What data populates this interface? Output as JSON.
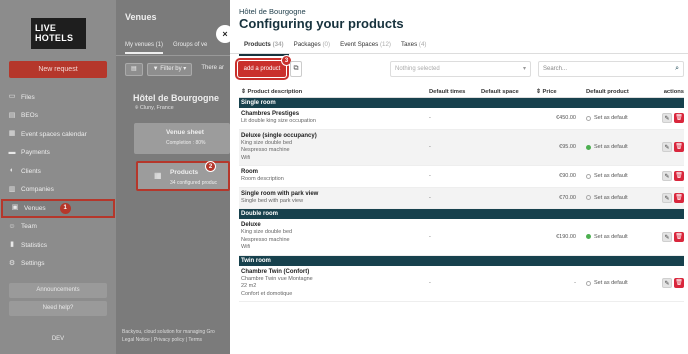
{
  "sidebar": {
    "logo": [
      "LIVE",
      "HOTELS"
    ],
    "new_request": "New request",
    "items": [
      {
        "label": "Files",
        "icon": "files-icon",
        "glyph": "▭"
      },
      {
        "label": "BEOs",
        "icon": "beo-icon",
        "glyph": "▤"
      },
      {
        "label": "Event spaces calendar",
        "icon": "calendar-icon",
        "glyph": "▦"
      },
      {
        "label": "Payments",
        "icon": "payment-icon",
        "glyph": "▬"
      },
      {
        "label": "Clients",
        "icon": "clients-icon",
        "glyph": "◐"
      },
      {
        "label": "Companies",
        "icon": "companies-icon",
        "glyph": "▥"
      },
      {
        "label": "Venues",
        "icon": "venues-icon",
        "glyph": "▣",
        "active": true,
        "badge": "1"
      },
      {
        "label": "Team",
        "icon": "team-icon",
        "glyph": "☺"
      },
      {
        "label": "Statistics",
        "icon": "statistics-icon",
        "glyph": "▮"
      },
      {
        "label": "Settings",
        "icon": "settings-icon",
        "glyph": "⚙"
      }
    ],
    "announcements": "Announcements",
    "help": "Need help?",
    "dev": "DEV"
  },
  "middle": {
    "title": "Venues",
    "tabs": [
      "My venues (1)",
      "Groups of ve"
    ],
    "filter_label": "Filter by",
    "there_are": "There ar",
    "hotel": "Hôtel de Bourgogne",
    "city": "Cluny, France",
    "venue_sheet": "Venue sheet",
    "venue_sheet_sub": "Completion : 80%",
    "products": "Products",
    "products_sub": "34 configured produc",
    "products_badge": "2",
    "footer": [
      "Backyou, cloud solution for managing Gro",
      "Legal Notice  |  Privacy policy  |  Terms"
    ]
  },
  "modal": {
    "subtitle": "Hôtel de Bourgogne",
    "title": "Configuring your products",
    "tabs": [
      {
        "label": "Products",
        "count": "(34)",
        "selected": true
      },
      {
        "label": "Packages",
        "count": "(0)"
      },
      {
        "label": "Event Spaces",
        "count": "(12)"
      },
      {
        "label": "Taxes",
        "count": "(4)"
      }
    ],
    "add_product": "add a product",
    "add_badge": "3",
    "selector_placeholder": "Nothing selected",
    "search_placeholder": "Search...",
    "columns": [
      "Product description",
      "Default times",
      "Default space",
      "Price",
      "Default product",
      "actions"
    ],
    "groups": [
      {
        "label": "Single room",
        "rows": [
          {
            "name": "Chambres Prestiges",
            "desc": [
              "Lit double king size occupation"
            ],
            "times": "-",
            "space": "",
            "price": "€450.00",
            "default_label": "Set as default",
            "is_default": false
          },
          {
            "name": "Deluxe (single occupancy)",
            "desc": [
              "King size double bed",
              "Nespresso machine",
              "Wifi"
            ],
            "times": "-",
            "space": "",
            "price": "€95.00",
            "default_label": "Set as default",
            "is_default": true
          },
          {
            "name": "Room",
            "desc": [
              "Room description"
            ],
            "times": "-",
            "space": "",
            "price": "€90.00",
            "default_label": "Set as default",
            "is_default": false
          },
          {
            "name": "Single room with park view",
            "desc": [
              "Single bed with park view"
            ],
            "times": "-",
            "space": "",
            "price": "€70.00",
            "default_label": "Set as default",
            "is_default": false
          }
        ]
      },
      {
        "label": "Double room",
        "rows": [
          {
            "name": "Deluxe",
            "desc": [
              "King size double bed",
              "Nespresso machine",
              "Wifi"
            ],
            "times": "-",
            "space": "",
            "price": "€190.00",
            "default_label": "Set as default",
            "is_default": true
          }
        ]
      },
      {
        "label": "Twin room",
        "rows": [
          {
            "name": "Chambre Twin (Confort)",
            "desc": [
              "Chambre Twin vue Montagne",
              "22 m2",
              "Confort et domotique"
            ],
            "times": "-",
            "space": "",
            "price": "-",
            "default_label": "Set as default",
            "is_default": false
          }
        ]
      }
    ]
  }
}
